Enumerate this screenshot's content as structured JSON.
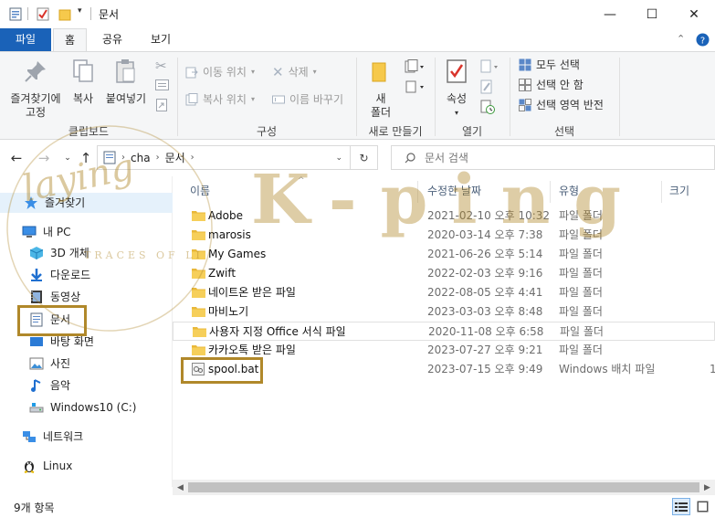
{
  "window": {
    "title": "문서",
    "controls": {
      "minimize": "—",
      "maximize": "☐",
      "close": "✕"
    }
  },
  "ribbon_tabs": [
    {
      "label": "파일"
    },
    {
      "label": "홈"
    },
    {
      "label": "공유"
    },
    {
      "label": "보기"
    }
  ],
  "ribbon": {
    "clipboard": {
      "pin_label": "즐겨찾기에\n고정",
      "copy_label": "복사",
      "paste_label": "붙여넣기",
      "group_label": "클립보드"
    },
    "organize": {
      "move_to": "이동 위치",
      "copy_to": "복사 위치",
      "delete": "삭제",
      "rename": "이름 바꾸기",
      "group_label": "구성"
    },
    "new": {
      "new_folder": "새\n폴더",
      "group_label": "새로 만들기"
    },
    "open": {
      "properties": "속성",
      "group_label": "열기"
    },
    "select": {
      "select_all": "모두 선택",
      "select_none": "선택 안 함",
      "invert": "선택 영역 반전",
      "group_label": "선택"
    }
  },
  "address": {
    "path": [
      "cha",
      "문서"
    ],
    "search_placeholder": "문서 검색"
  },
  "sidebar": {
    "items": [
      {
        "label": "즐겨찾기",
        "icon": "star-icon"
      },
      {
        "label": "내 PC",
        "icon": "pc-icon"
      },
      {
        "label": "3D 개체",
        "icon": "cube-icon"
      },
      {
        "label": "다운로드",
        "icon": "download-icon"
      },
      {
        "label": "동영상",
        "icon": "video-icon"
      },
      {
        "label": "문서",
        "icon": "document-icon"
      },
      {
        "label": "바탕 화면",
        "icon": "desktop-icon"
      },
      {
        "label": "사진",
        "icon": "picture-icon"
      },
      {
        "label": "음악",
        "icon": "music-icon"
      },
      {
        "label": "Windows10 (C:)",
        "icon": "drive-icon"
      },
      {
        "label": "네트워크",
        "icon": "network-icon"
      },
      {
        "label": "Linux",
        "icon": "linux-icon"
      }
    ]
  },
  "columns": {
    "name": "이름",
    "date": "수정한 날짜",
    "type": "유형",
    "size": "크기"
  },
  "files": [
    {
      "name": "Adobe",
      "date": "2021-02-10 오후 10:32",
      "type": "파일 폴더",
      "size": ""
    },
    {
      "name": "marosis",
      "date": "2020-03-14 오후 7:38",
      "type": "파일 폴더",
      "size": ""
    },
    {
      "name": "My Games",
      "date": "2021-06-26 오후 5:14",
      "type": "파일 폴더",
      "size": ""
    },
    {
      "name": "Zwift",
      "date": "2022-02-03 오후 9:16",
      "type": "파일 폴더",
      "size": ""
    },
    {
      "name": "네이트온 받은 파일",
      "date": "2022-08-05 오후 4:41",
      "type": "파일 폴더",
      "size": ""
    },
    {
      "name": "마비노기",
      "date": "2023-03-03 오후 8:48",
      "type": "파일 폴더",
      "size": ""
    },
    {
      "name": "사용자 지정 Office 서식 파일",
      "date": "2020-11-08 오후 6:58",
      "type": "파일 폴더",
      "size": ""
    },
    {
      "name": "카카오톡 받은 파일",
      "date": "2023-07-27 오후 9:21",
      "type": "파일 폴더",
      "size": ""
    },
    {
      "name": "spool.bat",
      "date": "2023-07-15 오후 9:49",
      "type": "Windows 배치 파일",
      "size": "1"
    }
  ],
  "status": {
    "count": "9개 항목"
  },
  "watermark": {
    "script": "laying",
    "brand": "K-ping",
    "tagline": "TRACES OF LI"
  },
  "colors": {
    "accent": "#1a62b8",
    "folder": "#f6c94c",
    "highlight": "#b0882a"
  }
}
